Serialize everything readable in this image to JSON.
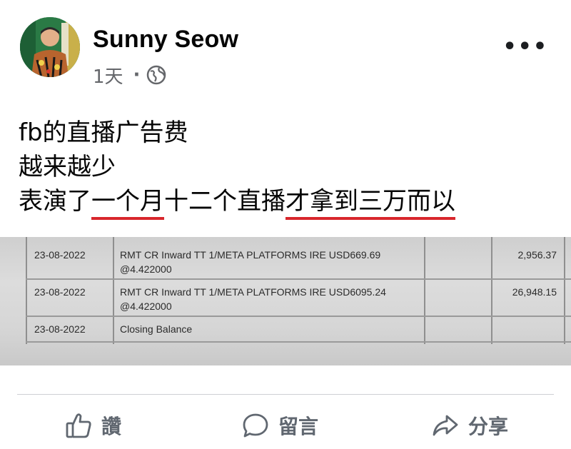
{
  "post": {
    "author": "Sunny Seow",
    "time": "1天",
    "separator": "·",
    "text_line1": "fb的直播广告费",
    "text_line2": "越来越少",
    "text_line3_a": "表演了",
    "text_line3_b": "一个月",
    "text_line3_c": "十二个直播",
    "text_line3_d": "才拿到三万而以",
    "more": "•••"
  },
  "statement": {
    "rows": [
      {
        "date": "23-08-2022",
        "desc1": "RMT CR Inward TT 1/META PLATFORMS IRE USD669.69",
        "desc2": "@4.422000",
        "amount": "2,956.37"
      },
      {
        "date": "23-08-2022",
        "desc1": "RMT CR Inward TT 1/META PLATFORMS IRE USD6095.24",
        "desc2": "@4.422000",
        "amount": "26,948.15"
      },
      {
        "date": "23-08-2022",
        "desc1": "Closing Balance",
        "desc2": "",
        "amount": ""
      }
    ]
  },
  "actions": {
    "like": "讚",
    "comment": "留言",
    "share": "分享"
  },
  "icons": {
    "privacy": "globe-icon",
    "like": "thumbs-up-icon",
    "comment": "speech-bubble-icon",
    "share": "share-arrow-icon",
    "more": "more-dots-icon"
  },
  "colors": {
    "underline": "#d8262c",
    "secondary_text": "#65676b",
    "action_text": "#606770"
  }
}
